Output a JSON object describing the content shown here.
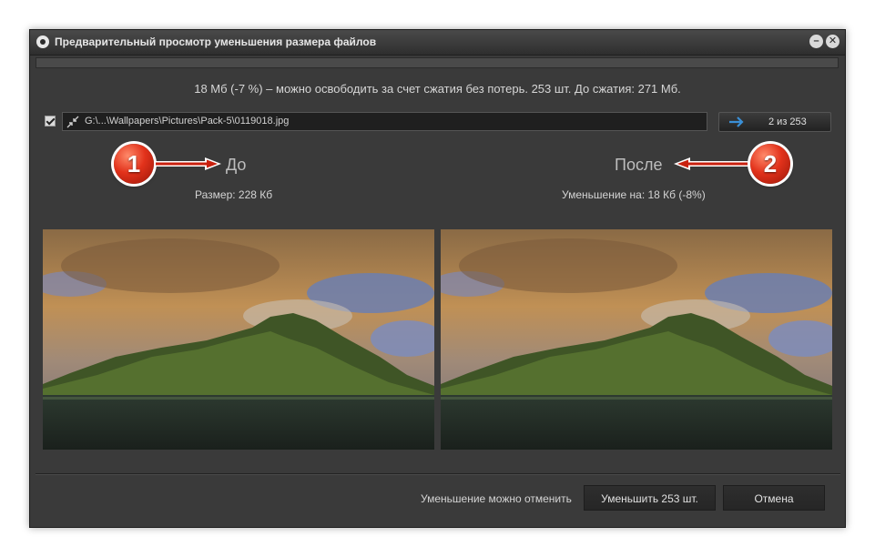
{
  "window": {
    "title": "Предварительный просмотр уменьшения размера файлов",
    "minimize_icon": "minimize-icon",
    "close_icon": "close-icon"
  },
  "summary": "18 Мб (-7 %) – можно освободить за счет сжатия без потерь. 253 шт. До сжатия: 271 Мб.",
  "file": {
    "checked": true,
    "path": "G:\\...\\Wallpapers\\Pictures\\Pack-5\\0119018.jpg",
    "counter": "2 из 253"
  },
  "before": {
    "label": "До",
    "size": "Размер: 228 Кб",
    "marker": "1"
  },
  "after": {
    "label": "После",
    "size": "Уменьшение на: 18 Кб (-8%)",
    "marker": "2"
  },
  "footer": {
    "note": "Уменьшение можно отменить",
    "reduce_button": "Уменьшить 253 шт.",
    "cancel_button": "Отмена"
  },
  "colors": {
    "window_bg": "#3a3a3a",
    "marker_red": "#e2321b",
    "arrow_red": "#c8200e",
    "nav_arrow_blue": "#3a8fd6"
  }
}
